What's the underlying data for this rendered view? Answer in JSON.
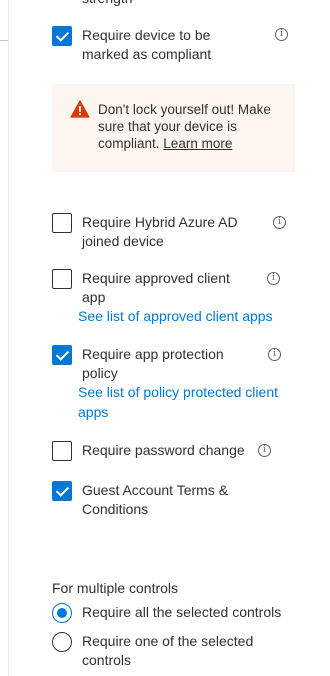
{
  "partial_text": "strength",
  "warning": {
    "text": "Don't lock yourself out! Make sure that your device is compliant.",
    "link": "Learn more"
  },
  "controls": [
    {
      "label": "Require device to be marked as compliant",
      "checked": true
    },
    {
      "label": "Require Hybrid Azure AD joined device",
      "checked": false
    },
    {
      "label": "Require approved client app",
      "checked": false,
      "link": "See list of approved client apps"
    },
    {
      "label": "Require app protection policy",
      "checked": true,
      "link": "See list of policy protected client apps"
    },
    {
      "label": "Require password change",
      "checked": false
    },
    {
      "label": "Guest Account Terms & Conditions",
      "checked": true
    }
  ],
  "multiple_controls": {
    "label": "For multiple controls",
    "options": [
      {
        "label": "Require all the selected controls",
        "selected": true
      },
      {
        "label": "Require one of the selected controls",
        "selected": false
      }
    ]
  }
}
